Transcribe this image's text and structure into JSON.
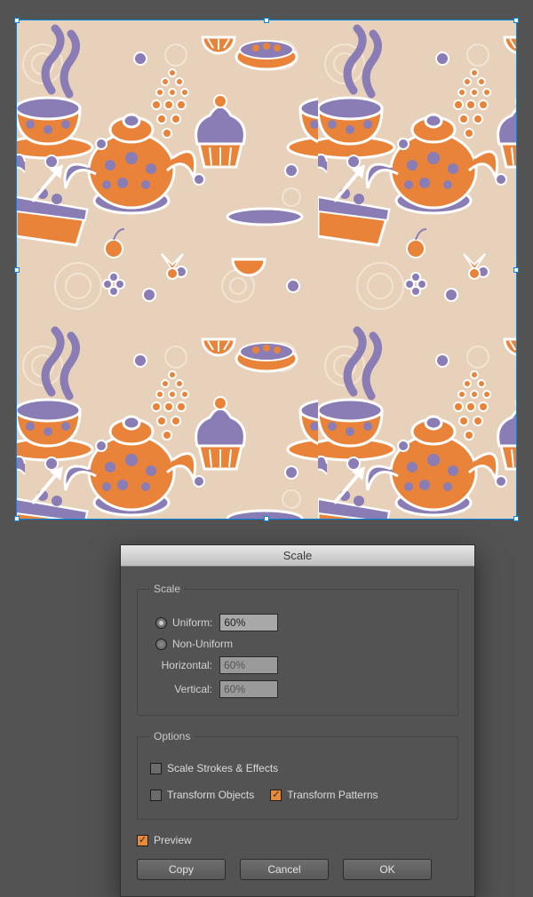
{
  "artboard": {
    "accent": "#0086e6",
    "pattern_bg": "#e8d1ba",
    "colors": {
      "orange": "#e9833a",
      "purple": "#8a7cb5",
      "cream": "#f7efe4"
    }
  },
  "dialog": {
    "title": "Scale",
    "scale_group": {
      "legend": "Scale",
      "uniform_label": "Uniform:",
      "uniform_value": "60%",
      "uniform_selected": true,
      "nonuniform_label": "Non-Uniform",
      "nonuniform_selected": false,
      "horizontal_label": "Horizontal:",
      "horizontal_value": "60%",
      "vertical_label": "Vertical:",
      "vertical_value": "60%"
    },
    "options_group": {
      "legend": "Options",
      "scale_strokes_label": "Scale Strokes & Effects",
      "scale_strokes_checked": false,
      "transform_objects_label": "Transform Objects",
      "transform_objects_checked": false,
      "transform_patterns_label": "Transform Patterns",
      "transform_patterns_checked": true
    },
    "preview_label": "Preview",
    "preview_checked": true,
    "buttons": {
      "copy": "Copy",
      "cancel": "Cancel",
      "ok": "OK"
    }
  }
}
